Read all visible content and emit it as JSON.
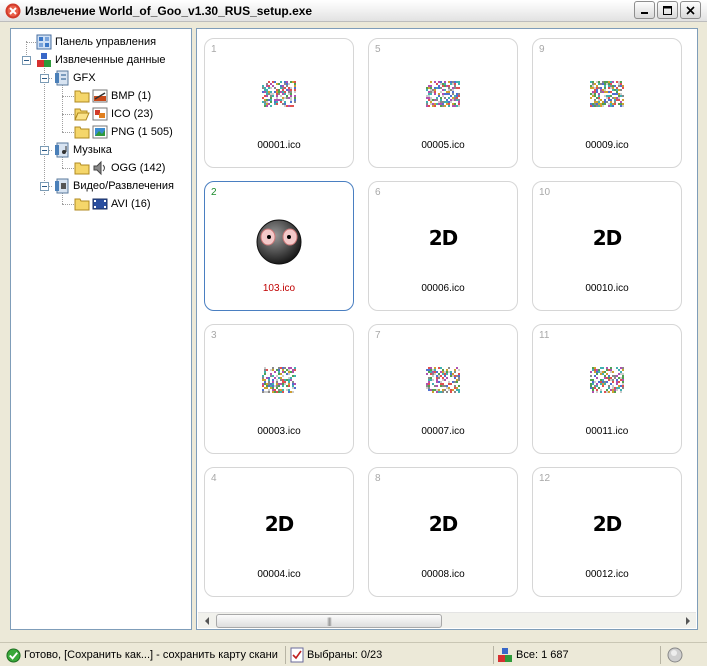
{
  "window": {
    "title": "Извлечение World_of_Goo_v1.30_RUS_setup.exe"
  },
  "tree": {
    "items": [
      {
        "label": "Панель управления",
        "icon": "control-panel-icon"
      },
      {
        "label": "Извлеченные данные",
        "icon": "extracted-data-icon"
      },
      {
        "label": "GFX",
        "icon": "gfx-icon"
      },
      {
        "label": "BMP (1)",
        "icon": "bmp-icon"
      },
      {
        "label": "ICO (23)",
        "icon": "ico-icon"
      },
      {
        "label": "PNG (1 505)",
        "icon": "png-icon"
      },
      {
        "label": "Музыка",
        "icon": "music-icon"
      },
      {
        "label": "OGG (142)",
        "icon": "ogg-icon"
      },
      {
        "label": "Видео/Развлечения",
        "icon": "video-icon"
      },
      {
        "label": "AVI (16)",
        "icon": "avi-icon"
      }
    ]
  },
  "tiles": [
    {
      "num": "1",
      "name": "00001.ico",
      "thumb": "noise"
    },
    {
      "num": "5",
      "name": "00005.ico",
      "thumb": "noise"
    },
    {
      "num": "9",
      "name": "00009.ico",
      "thumb": "noise"
    },
    {
      "num": "2",
      "name": "103.ico",
      "thumb": "goo-ball",
      "selected": true
    },
    {
      "num": "6",
      "name": "00006.ico",
      "thumb": "2d"
    },
    {
      "num": "10",
      "name": "00010.ico",
      "thumb": "2d"
    },
    {
      "num": "3",
      "name": "00003.ico",
      "thumb": "noise"
    },
    {
      "num": "7",
      "name": "00007.ico",
      "thumb": "noise"
    },
    {
      "num": "11",
      "name": "00011.ico",
      "thumb": "noise"
    },
    {
      "num": "4",
      "name": "00004.ico",
      "thumb": "2d"
    },
    {
      "num": "8",
      "name": "00008.ico",
      "thumb": "2d"
    },
    {
      "num": "12",
      "name": "00012.ico",
      "thumb": "2d"
    }
  ],
  "thumb_text": {
    "2d": "2D"
  },
  "statusbar": {
    "status_text": "Готово, [Сохранить как...] - сохранить карту скани",
    "selected_text": "Выбраны: 0/23",
    "total_text": "Все: 1 687"
  },
  "colors": {
    "selected_border": "#4a7fc1",
    "selected_name": "#c00000",
    "selected_num": "#1a8a2a"
  }
}
